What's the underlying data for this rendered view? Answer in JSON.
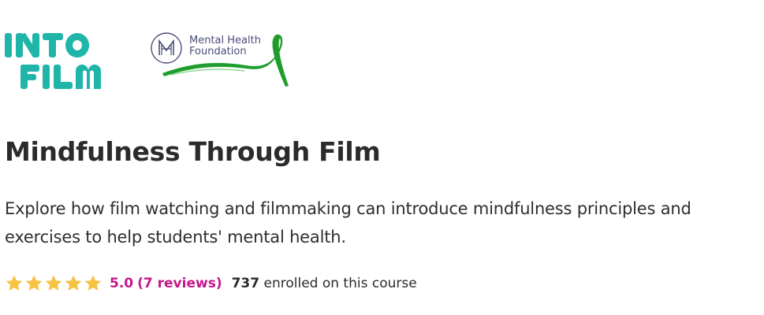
{
  "logos": {
    "intofilm": {
      "line1": "INTO",
      "line2": "FILM",
      "color": "#1fb5a8"
    },
    "mhf": {
      "line1": "Mental Health",
      "line2": "Foundation",
      "mark_letter": "MH",
      "text_color": "#4a4d7a",
      "ribbon_color": "#1e9d2c"
    }
  },
  "course": {
    "title": "Mindfulness Through Film",
    "description": "Explore how film watching and filmmaking can introduce mindfulness principles and exercises to help students' mental health.",
    "rating": {
      "stars": 5,
      "score": "5.0",
      "reviews_label": "(7 reviews)",
      "star_color": "#f6c343",
      "link_color": "#c4178a"
    },
    "enrollment": {
      "count": "737",
      "label": "enrolled on this course"
    }
  }
}
